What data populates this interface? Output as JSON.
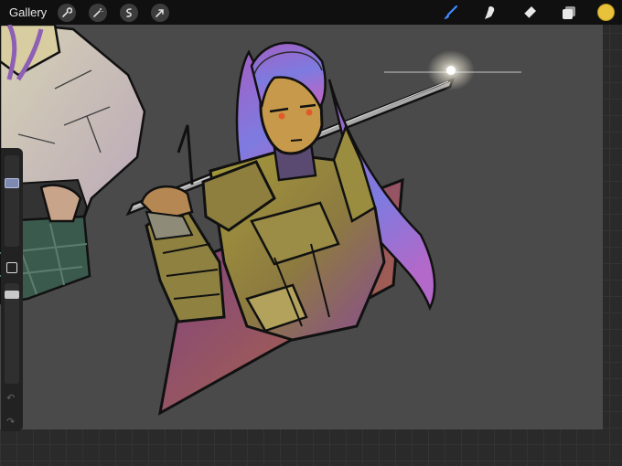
{
  "toolbar": {
    "gallery_label": "Gallery",
    "left_tools": [
      {
        "name": "wrench-icon"
      },
      {
        "name": "magic-wand-icon"
      },
      {
        "name": "selection-icon"
      },
      {
        "name": "transform-arrow-icon"
      }
    ],
    "right_tools": [
      {
        "name": "brush-icon",
        "active": true,
        "color": "#3f8cff"
      },
      {
        "name": "smudge-icon"
      },
      {
        "name": "eraser-icon"
      },
      {
        "name": "layers-icon"
      }
    ],
    "current_color": "#e8c23a"
  },
  "sidebar": {
    "brush_size_level": 0.2,
    "opacity_level": 0.92,
    "undo_symbol": "↶",
    "redo_symbol": "↷"
  },
  "colors": {
    "canvas": "#4a4a4a",
    "accent": "#3f8cff"
  }
}
